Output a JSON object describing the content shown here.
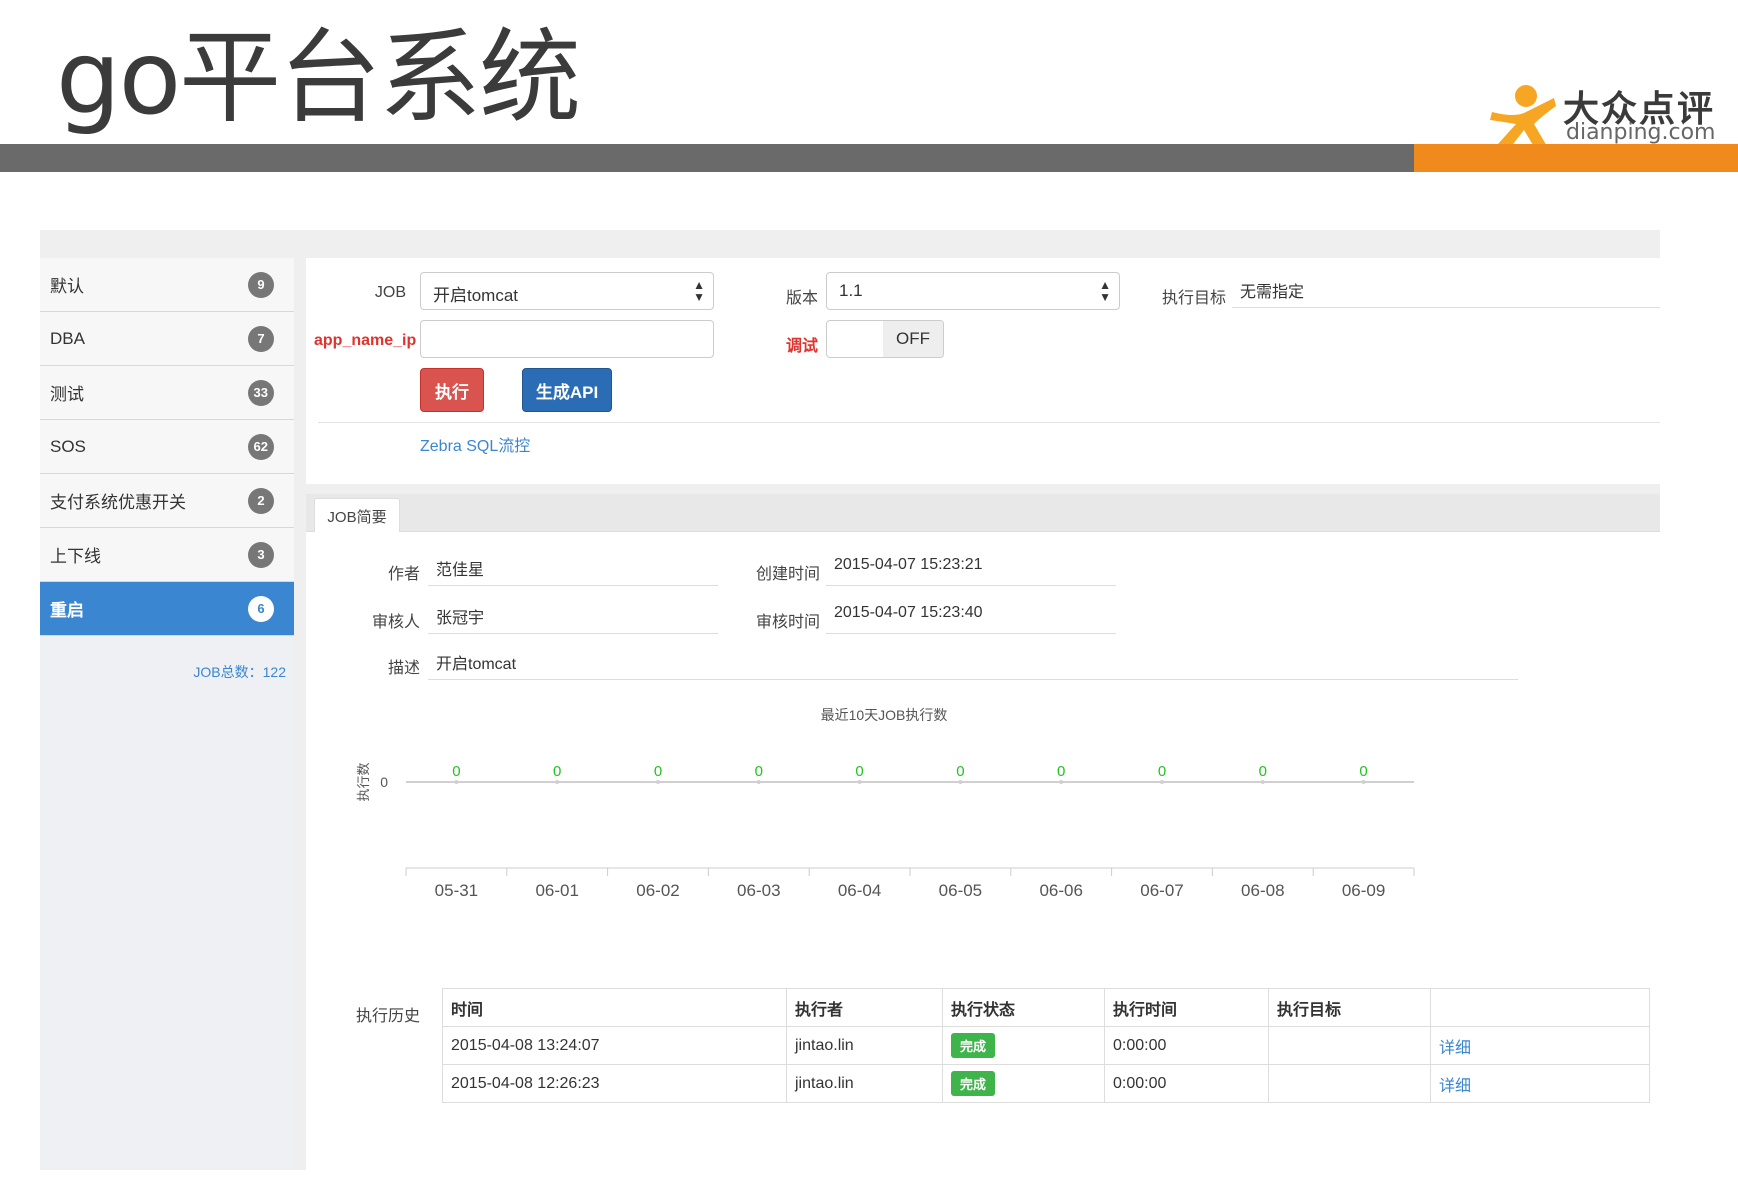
{
  "slide": {
    "title": "go平台系统",
    "logo_cn": "大众点评",
    "logo_en": "dianping.com",
    "colors": {
      "bar_gray": "#6a6a6a",
      "bar_orange": "#f08a1c",
      "logo_orange": "#f6a623"
    }
  },
  "sidebar": {
    "items": [
      {
        "label": "默认",
        "count": "9"
      },
      {
        "label": "DBA",
        "count": "7"
      },
      {
        "label": "测试",
        "count": "33"
      },
      {
        "label": "SOS",
        "count": "62"
      },
      {
        "label": "支付系统优惠开关",
        "count": "2"
      },
      {
        "label": "上下线",
        "count": "3"
      },
      {
        "label": "重启",
        "count": "6",
        "active": true
      }
    ],
    "job_total": "JOB总数：122"
  },
  "form": {
    "job_label": "JOB",
    "job_value": "开启tomcat",
    "version_label": "版本",
    "version_value": "1.1",
    "target_label": "执行目标",
    "target_value": "无需指定",
    "app_name_label": "app_name_ip",
    "app_name_value": "",
    "debug_label": "调试",
    "debug_state": "OFF",
    "run_button": "执行",
    "api_button": "生成API",
    "zebra_link": "Zebra SQL流控"
  },
  "tab": {
    "label": "JOB简要"
  },
  "detail": {
    "author_label": "作者",
    "author_value": "范佳星",
    "created_label": "创建时间",
    "created_value": "2015-04-07 15:23:21",
    "reviewer_label": "审核人",
    "reviewer_value": "张冠宇",
    "reviewed_label": "审核时间",
    "reviewed_value": "2015-04-07 15:23:40",
    "desc_label": "描述",
    "desc_value": "开启tomcat"
  },
  "chart_data": {
    "type": "line",
    "title": "最近10天JOB执行数",
    "ylabel": "执行数",
    "categories": [
      "05-31",
      "06-01",
      "06-02",
      "06-03",
      "06-04",
      "06-05",
      "06-06",
      "06-07",
      "06-08",
      "06-09"
    ],
    "values": [
      0,
      0,
      0,
      0,
      0,
      0,
      0,
      0,
      0,
      0
    ],
    "yticks": [
      "0"
    ],
    "label_color": "#22c322"
  },
  "history": {
    "label": "执行历史",
    "headers": [
      "时间",
      "执行者",
      "执行状态",
      "执行时间",
      "执行目标",
      ""
    ],
    "rows": [
      {
        "time": "2015-04-08 13:24:07",
        "executor": "jintao.lin",
        "status": "完成",
        "duration": "0:00:00",
        "target": "",
        "link": "详细"
      },
      {
        "time": "2015-04-08 12:26:23",
        "executor": "jintao.lin",
        "status": "完成",
        "duration": "0:00:00",
        "target": "",
        "link": "详细"
      }
    ]
  }
}
